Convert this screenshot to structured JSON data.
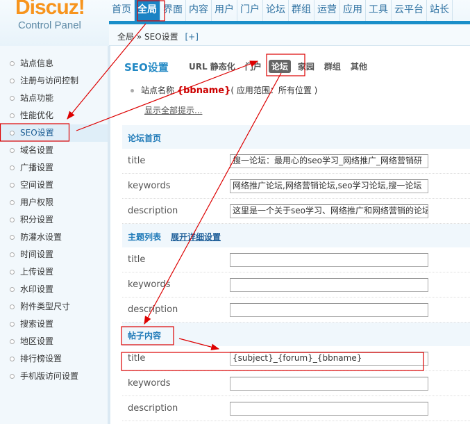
{
  "logo": {
    "brand": "Discuz!",
    "sub": "Control Panel"
  },
  "nav": [
    "首页",
    "全局",
    "界面",
    "内容",
    "用户",
    "门户",
    "论坛",
    "群组",
    "运营",
    "应用",
    "工具",
    "云平台",
    "站长"
  ],
  "breadcrumb": {
    "root": "全局",
    "sep": "»",
    "current": "SEO设置",
    "plus": "[+]"
  },
  "sidebar": [
    "站点信息",
    "注册与访问控制",
    "站点功能",
    "性能优化",
    "SEO设置",
    "域名设置",
    "广播设置",
    "空间设置",
    "用户权限",
    "积分设置",
    "防灌水设置",
    "时间设置",
    "上传设置",
    "水印设置",
    "附件类型尺寸",
    "搜索设置",
    "地区设置",
    "排行榜设置",
    "手机版访问设置"
  ],
  "page_title": "SEO设置",
  "tabs": [
    "URL 静态化",
    "门户",
    "论坛",
    "家园",
    "群组",
    "其他"
  ],
  "tip": {
    "label": "站点名称",
    "var": "{bbname}",
    "scope": "( 应用范围：所有位置 )",
    "show_all": "显示全部提示..."
  },
  "sections": [
    {
      "title": "论坛首页",
      "link": "",
      "rows": [
        {
          "label": "title",
          "value": "搜一论坛：最用心的seo学习_网络推广_网络营销研"
        },
        {
          "label": "keywords",
          "value": "网络推广论坛,网络营销论坛,seo学习论坛,搜一论坛"
        },
        {
          "label": "description",
          "value": "这里是一个关于seo学习、网络推广和网络营销的论坛"
        }
      ]
    },
    {
      "title": "主题列表",
      "link": "展开详细设置",
      "rows": [
        {
          "label": "title",
          "value": ""
        },
        {
          "label": "keywords",
          "value": ""
        },
        {
          "label": "description",
          "value": ""
        }
      ]
    },
    {
      "title": "帖子内容",
      "link": "",
      "rows": [
        {
          "label": "title",
          "value": "{subject}_{forum}_{bbname}"
        },
        {
          "label": "keywords",
          "value": ""
        },
        {
          "label": "description",
          "value": ""
        }
      ]
    }
  ],
  "colors": {
    "accent": "#1a83c4",
    "annotation": "#cc0000",
    "logo": "#f7941d"
  }
}
